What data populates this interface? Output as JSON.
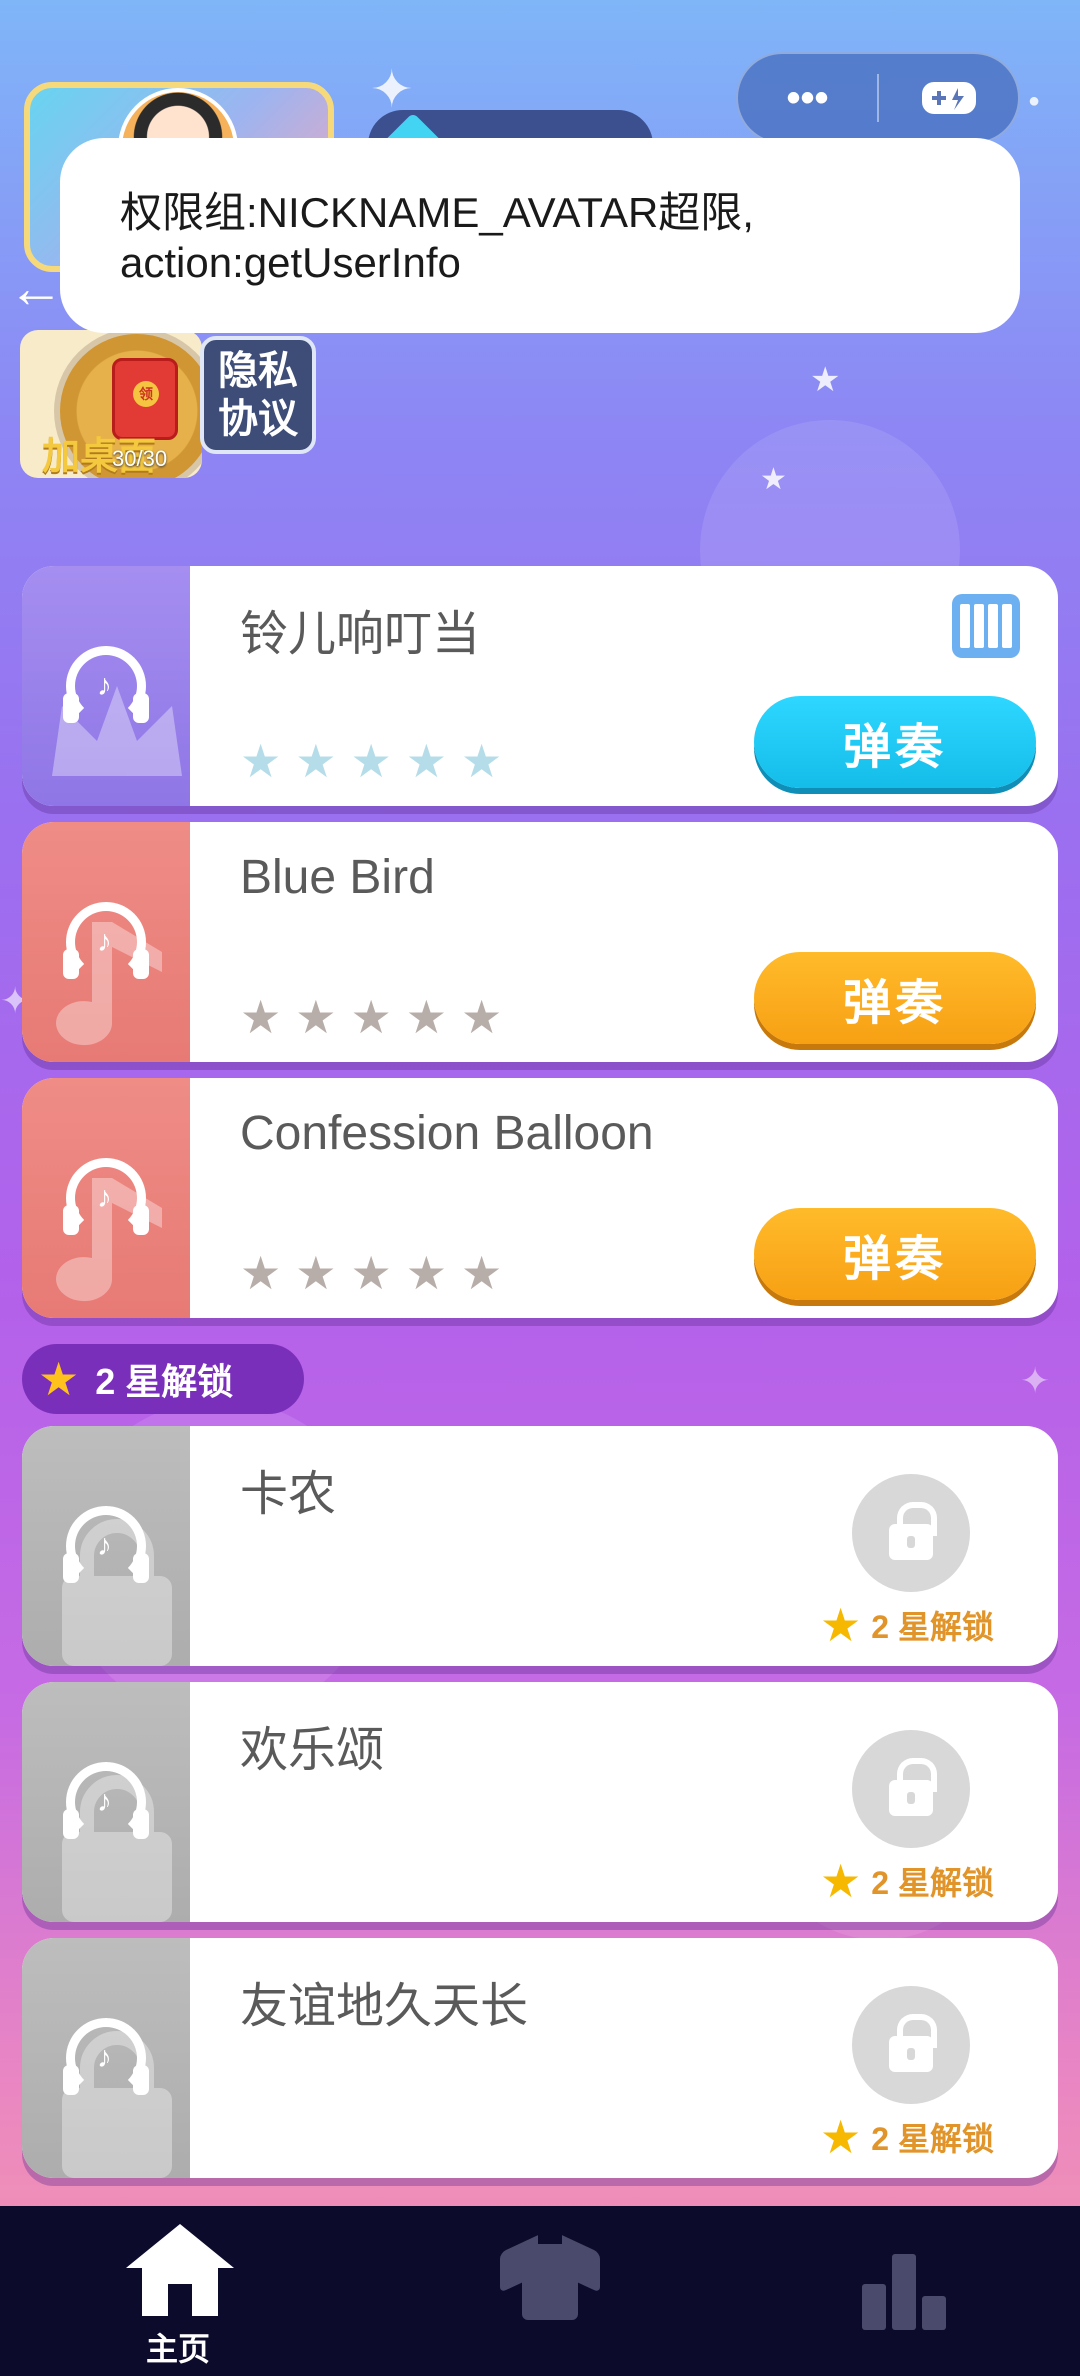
{
  "toast": {
    "line1": "权限组:NICKNAME_AVATAR超限,",
    "line2": "action:getUserInfo"
  },
  "capsule": {
    "more_icon": "•••",
    "game_icon": "gamepad-icon"
  },
  "desk_badge": {
    "label": "加桌面",
    "count": "30/30",
    "envelope_text": "领"
  },
  "privacy": {
    "line1": "隐私",
    "line2": "协议"
  },
  "section_unlock": {
    "label": "2 星解锁"
  },
  "songs": [
    {
      "title": "铃儿响叮当",
      "play_label": "弹奏"
    },
    {
      "title": "Blue Bird",
      "play_label": "弹奏"
    },
    {
      "title": "Confession Balloon",
      "play_label": "弹奏"
    }
  ],
  "locked_songs": [
    {
      "title": "卡农",
      "unlock_label": "2 星解锁"
    },
    {
      "title": "欢乐颂",
      "unlock_label": "2 星解锁"
    },
    {
      "title": "友谊地久天长",
      "unlock_label": "2 星解锁"
    }
  ],
  "nav": {
    "home_label": "主页"
  },
  "colors": {
    "play_cyan": "#14bde9",
    "play_orange": "#f7a014",
    "nav_bg": "#0c0b2c"
  }
}
